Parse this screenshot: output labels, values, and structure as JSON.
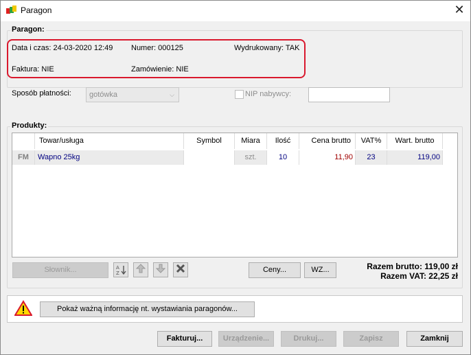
{
  "window": {
    "title": "Paragon",
    "close_glyph": "✕"
  },
  "header_group": {
    "label": "Paragon:",
    "data_czas": "Data i czas: 24-03-2020 12:49",
    "numer": "Numer: 000125",
    "wydrukowany": "Wydrukowany: TAK",
    "faktura": "Faktura: NIE",
    "zamowienie": "Zamówienie: NIE"
  },
  "payment": {
    "label": "Sposób płatności:",
    "value": "gotówka",
    "nip_label": "NIP nabywcy:",
    "nip_value": ""
  },
  "products": {
    "label": "Produkty:",
    "columns": [
      "Towar/usługa",
      "Symbol",
      "Miara",
      "Ilość",
      "Cena brutto",
      "VAT%",
      "Wart. brutto"
    ],
    "rows": [
      {
        "marker": "FM",
        "towar": "Wapno 25kg",
        "symbol": "",
        "miara": "szt.",
        "ilosc": "10",
        "cena": "11,90",
        "vat": "23",
        "wart": "119,00"
      }
    ]
  },
  "product_toolbar": {
    "slownik": "Słownik...",
    "ceny": "Ceny...",
    "wz": "WZ...",
    "sort_icon": "sort-az-icon",
    "up_icon": "arrow-up-icon",
    "down_icon": "arrow-down-icon",
    "delete_icon": "delete-x-icon"
  },
  "totals": {
    "brutto": "Razem brutto: 119,00 zł",
    "vat": "Razem VAT: 22,25 zł"
  },
  "info": {
    "warning_icon": "warning-icon",
    "button": "Pokaż ważną informację nt. wystawiania paragonów..."
  },
  "footer": {
    "fakturuj": "Fakturuj...",
    "urzadzenie": "Urządzenie...",
    "drukuj": "Drukuj...",
    "zapisz": "Zapisz",
    "zamknij": "Zamknij"
  },
  "colors": {
    "accent_red": "#d9182d",
    "row_text_blue": "#000080"
  }
}
